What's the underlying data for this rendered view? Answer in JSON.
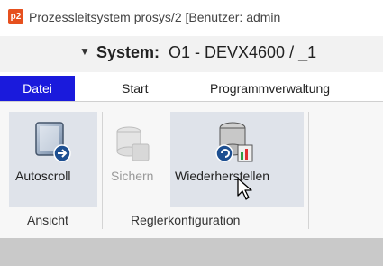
{
  "window": {
    "title": "Prozessleitsystem prosys/2  [Benutzer: admin",
    "app_icon": "p2"
  },
  "system_bar": {
    "chevron": "⫪",
    "label": "System:",
    "value": "O1 - DEVX4600 / _1"
  },
  "menu": {
    "items": [
      "Datei",
      "Start",
      "Programmverwaltung"
    ],
    "active": "Datei"
  },
  "ribbon": {
    "buttons": [
      {
        "label": "Autoscroll",
        "icon": "document-scroll-icon",
        "enabled": true
      },
      {
        "label": "Sichern",
        "icon": "database-save-icon",
        "enabled": false
      },
      {
        "label": "Wiederherstellen",
        "icon": "database-restore-icon",
        "enabled": true
      }
    ],
    "groups": [
      "Ansicht",
      "Reglerkonfiguration"
    ]
  },
  "colors": {
    "active_menu": "#1a1adc",
    "button_highlight": "#dfe3ea"
  }
}
